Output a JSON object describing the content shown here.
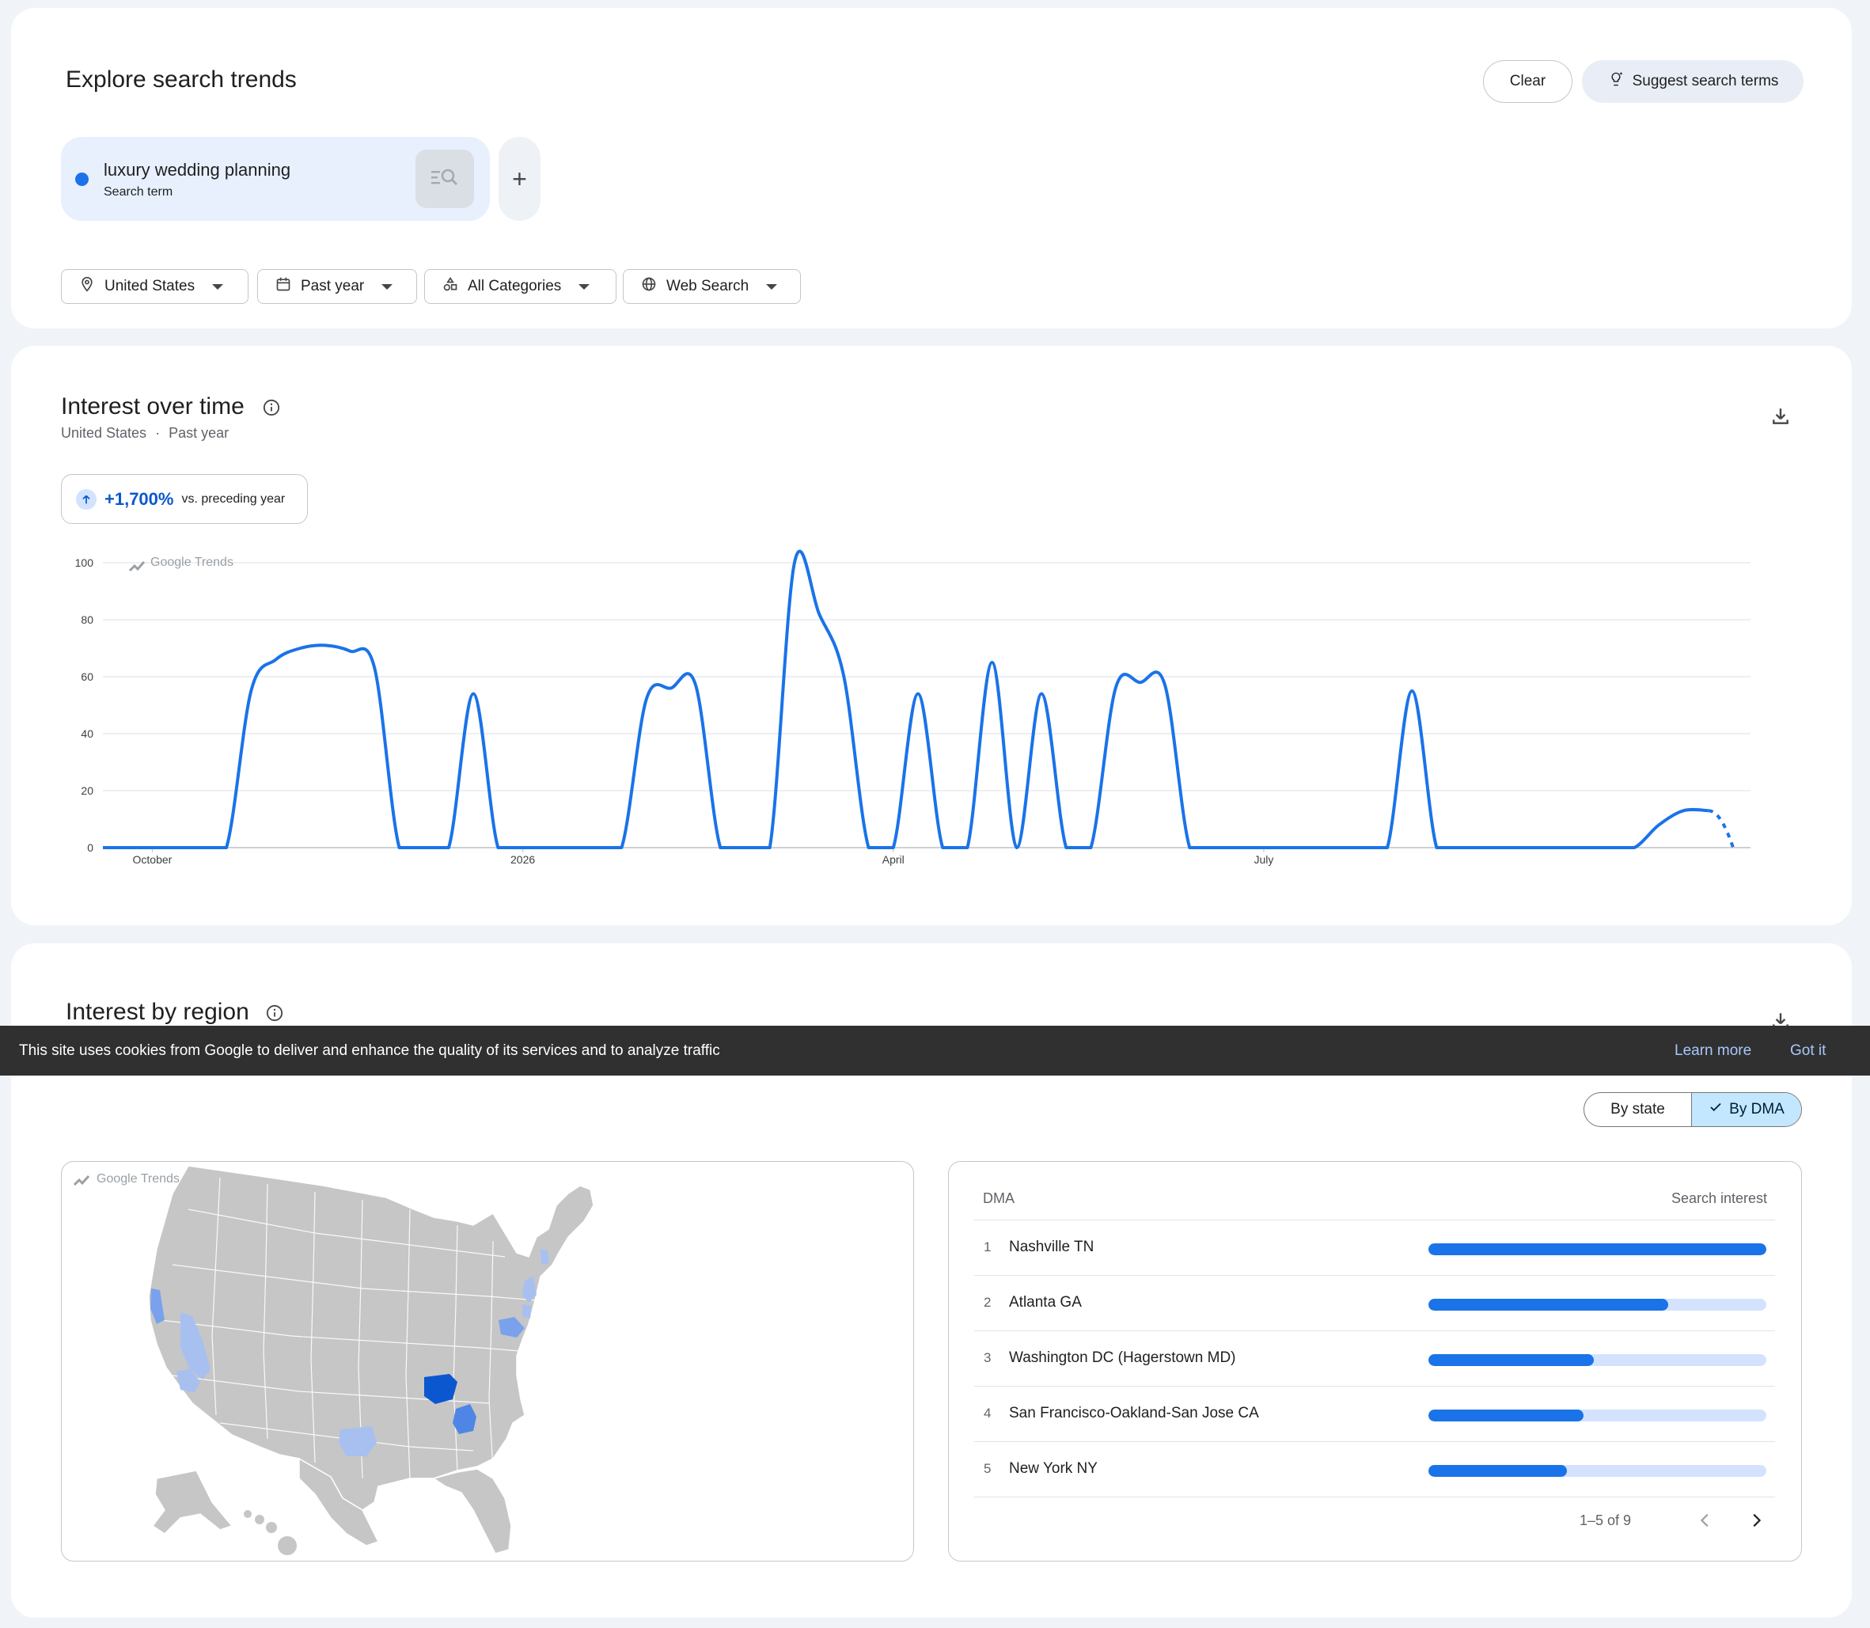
{
  "explore": {
    "title": "Explore search trends",
    "clear_label": "Clear",
    "suggest_label": "Suggest search terms",
    "term": {
      "label": "luxury wedding planning",
      "sub": "Search term"
    },
    "add_label": "+",
    "filters": {
      "location": "United States",
      "time": "Past year",
      "category": "All Categories",
      "type": "Web Search"
    }
  },
  "interest_over_time": {
    "title": "Interest over time",
    "sub_location": "United States",
    "sub_sep": "·",
    "sub_period": "Past year",
    "change_value": "+1,700%",
    "change_text": "vs. preceding year",
    "watermark": "Google Trends"
  },
  "chart_data": {
    "type": "line",
    "y_ticks": [
      "100",
      "80",
      "60",
      "40",
      "20",
      "0"
    ],
    "ylim": [
      0,
      100
    ],
    "x_tick_labels": [
      "October",
      "2026",
      "April",
      "July"
    ],
    "x_tick_weeks": [
      2,
      17,
      32,
      47
    ],
    "grid": true,
    "series": [
      {
        "values": [
          0,
          0,
          0,
          0,
          0,
          0,
          55,
          66,
          70,
          71,
          69,
          63,
          0,
          0,
          0,
          54,
          0,
          0,
          0,
          0,
          0,
          0,
          0,
          0,
          0,
          0,
          0,
          0,
          0,
          0,
          0,
          0,
          0,
          0,
          0,
          0,
          0,
          0,
          0,
          0,
          0,
          0,
          0,
          0,
          0,
          0,
          0,
          0,
          0,
          0,
          0,
          0,
          0,
          0,
          0,
          0,
          0,
          0,
          0,
          0,
          0,
          0,
          0,
          0,
          0
        ],
        "color": "#1a73e8"
      }
    ],
    "weekly_values": [
      0,
      0,
      0,
      0,
      0,
      0,
      55,
      66,
      70,
      71,
      69,
      63,
      0,
      0,
      0,
      54,
      0,
      0,
      0,
      0,
      0,
      0,
      52,
      56,
      57,
      0,
      0,
      0,
      100,
      82,
      60,
      0,
      0,
      54,
      0,
      0,
      65,
      0,
      54,
      0,
      0,
      56,
      58,
      57,
      0,
      0,
      0,
      0,
      0,
      0,
      0,
      0,
      0,
      55,
      0,
      0,
      0,
      0,
      0,
      0,
      0,
      0,
      0,
      8,
      13,
      13,
      0
    ],
    "partial_last_point": true
  },
  "interest_by_region": {
    "title": "Interest by region",
    "by_state": "By state",
    "by_dma": "By DMA",
    "watermark": "Google Trends",
    "table": {
      "col_dma": "DMA",
      "col_interest": "Search interest",
      "rows": [
        {
          "rank": "1",
          "name": "Nashville TN",
          "value": 100
        },
        {
          "rank": "2",
          "name": "Atlanta GA",
          "value": 71
        },
        {
          "rank": "3",
          "name": "Washington DC (Hagerstown MD)",
          "value": 49
        },
        {
          "rank": "4",
          "name": "San Francisco-Oakland-San Jose CA",
          "value": 46
        },
        {
          "rank": "5",
          "name": "New York NY",
          "value": 41
        }
      ],
      "pager": "1–5 of 9"
    }
  },
  "cookie": {
    "text": "This site uses cookies from Google to deliver and enhance the quality of its services and to analyze traffic",
    "learn_more": "Learn more",
    "got_it": "Got it"
  },
  "colors": {
    "accent": "#1a73e8",
    "map_base": "#c6c6c6",
    "map_high": "#0b57d0",
    "map_mid": "#4f86e6",
    "map_low": "#a8c0f0"
  }
}
